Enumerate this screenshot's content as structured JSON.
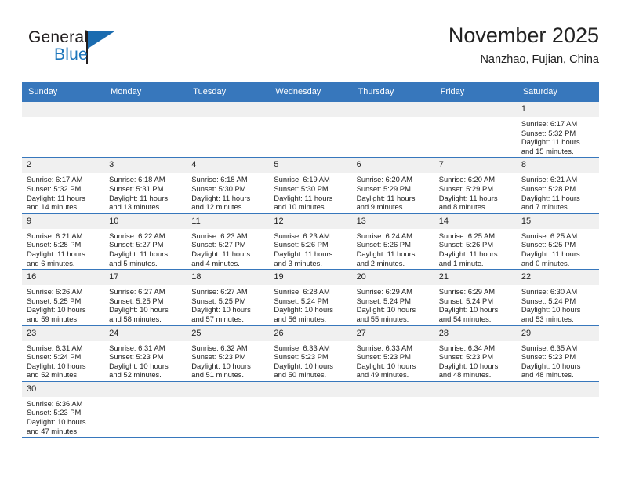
{
  "brand": {
    "name_part1": "General",
    "name_part2": "Blue",
    "logo_icon": "triangle-flag-icon"
  },
  "header": {
    "title": "November 2025",
    "subtitle": "Nanzhao, Fujian, China"
  },
  "weekday_headers": [
    "Sunday",
    "Monday",
    "Tuesday",
    "Wednesday",
    "Thursday",
    "Friday",
    "Saturday"
  ],
  "colors": {
    "header_blue": "#3777bc",
    "daynum_gray": "#f0f0f0",
    "brand_blue": "#1b75bb",
    "text": "#222222"
  },
  "weeks": [
    [
      {
        "empty": true
      },
      {
        "empty": true
      },
      {
        "empty": true
      },
      {
        "empty": true
      },
      {
        "empty": true
      },
      {
        "empty": true
      },
      {
        "day": "1",
        "sunrise": "Sunrise: 6:17 AM",
        "sunset": "Sunset: 5:32 PM",
        "daylight1": "Daylight: 11 hours",
        "daylight2": "and 15 minutes."
      }
    ],
    [
      {
        "day": "2",
        "sunrise": "Sunrise: 6:17 AM",
        "sunset": "Sunset: 5:32 PM",
        "daylight1": "Daylight: 11 hours",
        "daylight2": "and 14 minutes."
      },
      {
        "day": "3",
        "sunrise": "Sunrise: 6:18 AM",
        "sunset": "Sunset: 5:31 PM",
        "daylight1": "Daylight: 11 hours",
        "daylight2": "and 13 minutes."
      },
      {
        "day": "4",
        "sunrise": "Sunrise: 6:18 AM",
        "sunset": "Sunset: 5:30 PM",
        "daylight1": "Daylight: 11 hours",
        "daylight2": "and 12 minutes."
      },
      {
        "day": "5",
        "sunrise": "Sunrise: 6:19 AM",
        "sunset": "Sunset: 5:30 PM",
        "daylight1": "Daylight: 11 hours",
        "daylight2": "and 10 minutes."
      },
      {
        "day": "6",
        "sunrise": "Sunrise: 6:20 AM",
        "sunset": "Sunset: 5:29 PM",
        "daylight1": "Daylight: 11 hours",
        "daylight2": "and 9 minutes."
      },
      {
        "day": "7",
        "sunrise": "Sunrise: 6:20 AM",
        "sunset": "Sunset: 5:29 PM",
        "daylight1": "Daylight: 11 hours",
        "daylight2": "and 8 minutes."
      },
      {
        "day": "8",
        "sunrise": "Sunrise: 6:21 AM",
        "sunset": "Sunset: 5:28 PM",
        "daylight1": "Daylight: 11 hours",
        "daylight2": "and 7 minutes."
      }
    ],
    [
      {
        "day": "9",
        "sunrise": "Sunrise: 6:21 AM",
        "sunset": "Sunset: 5:28 PM",
        "daylight1": "Daylight: 11 hours",
        "daylight2": "and 6 minutes."
      },
      {
        "day": "10",
        "sunrise": "Sunrise: 6:22 AM",
        "sunset": "Sunset: 5:27 PM",
        "daylight1": "Daylight: 11 hours",
        "daylight2": "and 5 minutes."
      },
      {
        "day": "11",
        "sunrise": "Sunrise: 6:23 AM",
        "sunset": "Sunset: 5:27 PM",
        "daylight1": "Daylight: 11 hours",
        "daylight2": "and 4 minutes."
      },
      {
        "day": "12",
        "sunrise": "Sunrise: 6:23 AM",
        "sunset": "Sunset: 5:26 PM",
        "daylight1": "Daylight: 11 hours",
        "daylight2": "and 3 minutes."
      },
      {
        "day": "13",
        "sunrise": "Sunrise: 6:24 AM",
        "sunset": "Sunset: 5:26 PM",
        "daylight1": "Daylight: 11 hours",
        "daylight2": "and 2 minutes."
      },
      {
        "day": "14",
        "sunrise": "Sunrise: 6:25 AM",
        "sunset": "Sunset: 5:26 PM",
        "daylight1": "Daylight: 11 hours",
        "daylight2": "and 1 minute."
      },
      {
        "day": "15",
        "sunrise": "Sunrise: 6:25 AM",
        "sunset": "Sunset: 5:25 PM",
        "daylight1": "Daylight: 11 hours",
        "daylight2": "and 0 minutes."
      }
    ],
    [
      {
        "day": "16",
        "sunrise": "Sunrise: 6:26 AM",
        "sunset": "Sunset: 5:25 PM",
        "daylight1": "Daylight: 10 hours",
        "daylight2": "and 59 minutes."
      },
      {
        "day": "17",
        "sunrise": "Sunrise: 6:27 AM",
        "sunset": "Sunset: 5:25 PM",
        "daylight1": "Daylight: 10 hours",
        "daylight2": "and 58 minutes."
      },
      {
        "day": "18",
        "sunrise": "Sunrise: 6:27 AM",
        "sunset": "Sunset: 5:25 PM",
        "daylight1": "Daylight: 10 hours",
        "daylight2": "and 57 minutes."
      },
      {
        "day": "19",
        "sunrise": "Sunrise: 6:28 AM",
        "sunset": "Sunset: 5:24 PM",
        "daylight1": "Daylight: 10 hours",
        "daylight2": "and 56 minutes."
      },
      {
        "day": "20",
        "sunrise": "Sunrise: 6:29 AM",
        "sunset": "Sunset: 5:24 PM",
        "daylight1": "Daylight: 10 hours",
        "daylight2": "and 55 minutes."
      },
      {
        "day": "21",
        "sunrise": "Sunrise: 6:29 AM",
        "sunset": "Sunset: 5:24 PM",
        "daylight1": "Daylight: 10 hours",
        "daylight2": "and 54 minutes."
      },
      {
        "day": "22",
        "sunrise": "Sunrise: 6:30 AM",
        "sunset": "Sunset: 5:24 PM",
        "daylight1": "Daylight: 10 hours",
        "daylight2": "and 53 minutes."
      }
    ],
    [
      {
        "day": "23",
        "sunrise": "Sunrise: 6:31 AM",
        "sunset": "Sunset: 5:24 PM",
        "daylight1": "Daylight: 10 hours",
        "daylight2": "and 52 minutes."
      },
      {
        "day": "24",
        "sunrise": "Sunrise: 6:31 AM",
        "sunset": "Sunset: 5:23 PM",
        "daylight1": "Daylight: 10 hours",
        "daylight2": "and 52 minutes."
      },
      {
        "day": "25",
        "sunrise": "Sunrise: 6:32 AM",
        "sunset": "Sunset: 5:23 PM",
        "daylight1": "Daylight: 10 hours",
        "daylight2": "and 51 minutes."
      },
      {
        "day": "26",
        "sunrise": "Sunrise: 6:33 AM",
        "sunset": "Sunset: 5:23 PM",
        "daylight1": "Daylight: 10 hours",
        "daylight2": "and 50 minutes."
      },
      {
        "day": "27",
        "sunrise": "Sunrise: 6:33 AM",
        "sunset": "Sunset: 5:23 PM",
        "daylight1": "Daylight: 10 hours",
        "daylight2": "and 49 minutes."
      },
      {
        "day": "28",
        "sunrise": "Sunrise: 6:34 AM",
        "sunset": "Sunset: 5:23 PM",
        "daylight1": "Daylight: 10 hours",
        "daylight2": "and 48 minutes."
      },
      {
        "day": "29",
        "sunrise": "Sunrise: 6:35 AM",
        "sunset": "Sunset: 5:23 PM",
        "daylight1": "Daylight: 10 hours",
        "daylight2": "and 48 minutes."
      }
    ],
    [
      {
        "day": "30",
        "sunrise": "Sunrise: 6:36 AM",
        "sunset": "Sunset: 5:23 PM",
        "daylight1": "Daylight: 10 hours",
        "daylight2": "and 47 minutes."
      },
      {
        "empty": true
      },
      {
        "empty": true
      },
      {
        "empty": true
      },
      {
        "empty": true
      },
      {
        "empty": true
      },
      {
        "empty": true
      }
    ]
  ]
}
